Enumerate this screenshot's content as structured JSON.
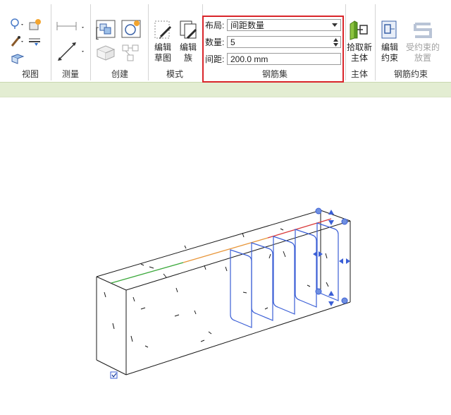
{
  "ribbon": {
    "panels": {
      "view": "视图",
      "measure": "测量",
      "create": "创建",
      "mode": "模式",
      "rebar_set": "钢筋集",
      "host": "主体",
      "rebar_constraints": "钢筋约束"
    },
    "mode_buttons": {
      "edit_sketch_line1": "编辑",
      "edit_sketch_line2": "草图",
      "edit_family_line1": "编辑",
      "edit_family_line2": "族"
    },
    "rebar_set": {
      "layout_label": "布局:",
      "layout_value": "间距数量",
      "quantity_label": "数量:",
      "quantity_value": "5",
      "spacing_label": "间距:",
      "spacing_value": "200.0 mm"
    },
    "host_buttons": {
      "pick_new_host_line1": "拾取新",
      "pick_new_host_line2": "主体"
    },
    "constraint_buttons": {
      "edit_constraints_line1": "编辑",
      "edit_constraints_line2": "约束",
      "constrained_placement_line1": "受约束的",
      "constrained_placement_line2": "放置"
    },
    "band_color": "#e3edd2",
    "highlight_color": "#d9252a"
  },
  "viewport": {
    "rebar_color": "#3b5fd6",
    "edge_color": "#1a1a1a"
  }
}
